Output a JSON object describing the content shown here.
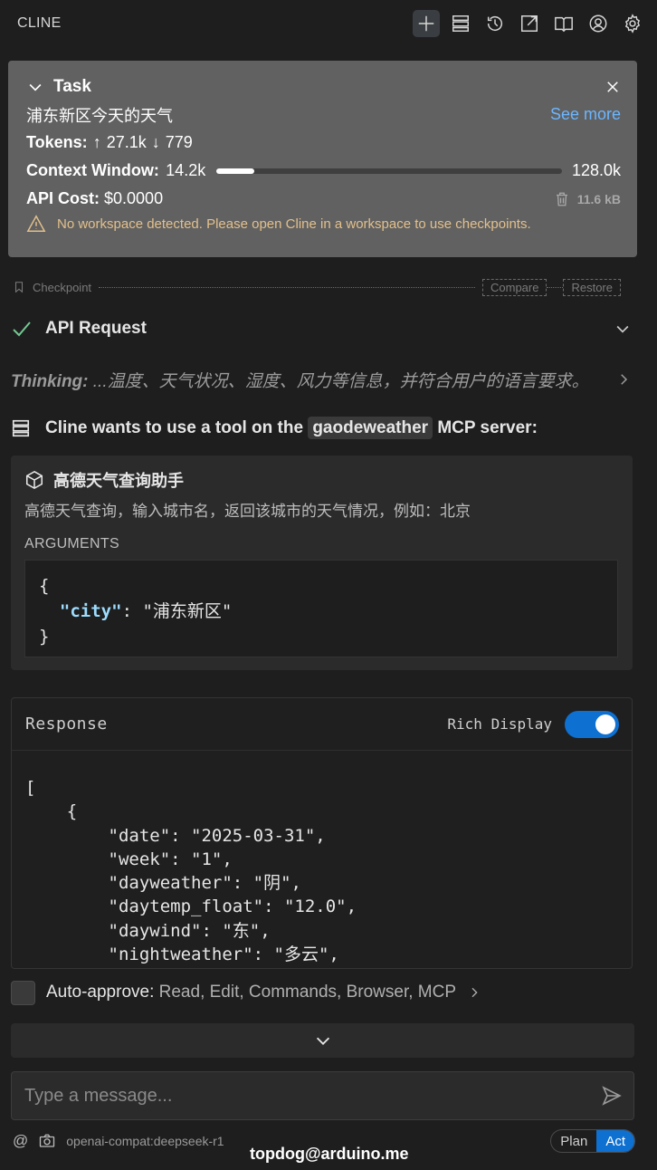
{
  "app": {
    "title": "CLINE"
  },
  "top_icons": [
    "plus-icon",
    "server-icon",
    "history-icon",
    "popout-icon",
    "book-icon",
    "account-icon",
    "gear-icon"
  ],
  "task": {
    "label": "Task",
    "text": "浦东新区今天的天气",
    "see_more": "See more",
    "tokens_label": "Tokens:",
    "tokens_in": "27.1k",
    "tokens_out": "779",
    "context_label": "Context Window:",
    "context_used": "14.2k",
    "context_max": "128.0k",
    "context_fraction": 0.11,
    "api_cost_label": "API Cost:",
    "api_cost": "$0.0000",
    "size": "11.6 kB",
    "warning": "No workspace detected. Please open Cline in a workspace to use checkpoints."
  },
  "checkpoint": {
    "label": "Checkpoint",
    "compare": "Compare",
    "restore": "Restore"
  },
  "api_request": {
    "label": "API Request"
  },
  "thinking": {
    "label": "Thinking:",
    "text": "...温度、天气状况、湿度、风力等信息，并符合用户的语言要求。"
  },
  "tool_use": {
    "prefix": "Cline wants to use a tool on the",
    "server": "gaodeweather",
    "suffix": "MCP server:",
    "tool_name": "高德天气查询助手",
    "description": "高德天气查询，输入城市名，返回该城市的天气情况，例如：北京",
    "arguments_label": "ARGUMENTS",
    "arg_key": "city",
    "arg_value": "浦东新区"
  },
  "response": {
    "title": "Response",
    "rich_display": "Rich Display",
    "rich_on": true,
    "lines": [
      "[",
      "    {",
      "        \"date\": \"2025-03-31\",",
      "        \"week\": \"1\",",
      "        \"dayweather\": \"阴\",",
      "        \"daytemp_float\": \"12.0\",",
      "        \"daywind\": \"东\",",
      "        \"nightweather\": \"多云\","
    ]
  },
  "auto_approve": {
    "label": "Auto-approve:",
    "items": "Read, Edit, Commands, Browser, MCP"
  },
  "input": {
    "placeholder": "Type a message..."
  },
  "bottom": {
    "model": "openai-compat:deepseek-r1",
    "plan": "Plan",
    "act": "Act"
  },
  "watermark": "topdog@arduino.me"
}
